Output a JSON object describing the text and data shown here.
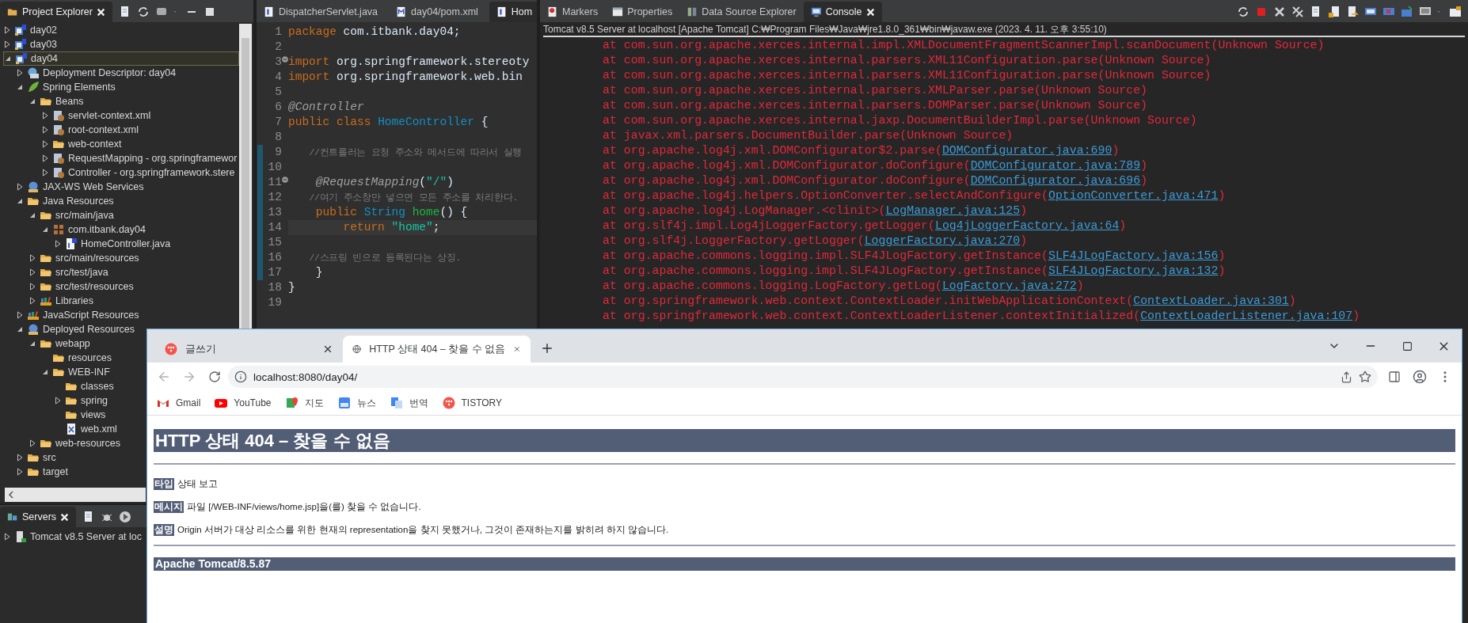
{
  "project_explorer": {
    "title": "Project Explorer",
    "tree": [
      {
        "label": "day02",
        "kind": "project",
        "expandable": true,
        "expanded": false,
        "selected": false
      },
      {
        "label": "day03",
        "kind": "project",
        "expandable": true,
        "expanded": false,
        "selected": false
      },
      {
        "label": "day04",
        "kind": "project",
        "expandable": true,
        "expanded": true,
        "selected": true,
        "children": [
          {
            "label": "Deployment Descriptor: day04",
            "kind": "descriptor",
            "expandable": true,
            "expanded": false,
            "selected": false
          },
          {
            "label": "Spring Elements",
            "kind": "spring",
            "expandable": true,
            "expanded": true,
            "selected": false,
            "children": [
              {
                "label": "Beans",
                "kind": "folder",
                "expandable": true,
                "expanded": true,
                "selected": false,
                "children": [
                  {
                    "label": "servlet-context.xml",
                    "kind": "bean-file",
                    "expandable": true,
                    "expanded": false,
                    "selected": false
                  },
                  {
                    "label": "root-context.xml",
                    "kind": "bean-file",
                    "expandable": true,
                    "expanded": false,
                    "selected": false
                  },
                  {
                    "label": "web-context",
                    "kind": "folder",
                    "expandable": true,
                    "expanded": false,
                    "selected": false
                  },
                  {
                    "label": "RequestMapping - org.springframewor",
                    "kind": "bean-file",
                    "expandable": true,
                    "expanded": false,
                    "selected": false
                  },
                  {
                    "label": "Controller - org.springframework.stere",
                    "kind": "bean-file",
                    "expandable": true,
                    "expanded": false,
                    "selected": false
                  }
                ]
              }
            ]
          },
          {
            "label": "JAX-WS Web Services",
            "kind": "services",
            "expandable": true,
            "expanded": false,
            "selected": false
          },
          {
            "label": "Java Resources",
            "kind": "folder",
            "expandable": true,
            "expanded": true,
            "selected": false,
            "children": [
              {
                "label": "src/main/java",
                "kind": "folder",
                "expandable": true,
                "expanded": true,
                "selected": false,
                "children": [
                  {
                    "label": "com.itbank.day04",
                    "kind": "package",
                    "expandable": true,
                    "expanded": true,
                    "selected": false,
                    "children": [
                      {
                        "label": "HomeController.java",
                        "kind": "java",
                        "expandable": true,
                        "expanded": false,
                        "selected": false
                      }
                    ]
                  }
                ]
              },
              {
                "label": "src/main/resources",
                "kind": "folder",
                "expandable": true,
                "expanded": false,
                "selected": false
              },
              {
                "label": "src/test/java",
                "kind": "folder",
                "expandable": true,
                "expanded": false,
                "selected": false
              },
              {
                "label": "src/test/resources",
                "kind": "folder",
                "expandable": true,
                "expanded": false,
                "selected": false
              },
              {
                "label": "Libraries",
                "kind": "library",
                "expandable": true,
                "expanded": false,
                "selected": false
              }
            ]
          },
          {
            "label": "JavaScript Resources",
            "kind": "library",
            "expandable": true,
            "expanded": false,
            "selected": false
          },
          {
            "label": "Deployed Resources",
            "kind": "services",
            "expandable": true,
            "expanded": true,
            "selected": false,
            "children": [
              {
                "label": "webapp",
                "kind": "folder",
                "expandable": true,
                "expanded": true,
                "selected": false,
                "children": [
                  {
                    "label": "resources",
                    "kind": "folder",
                    "expandable": false,
                    "selected": false
                  },
                  {
                    "label": "WEB-INF",
                    "kind": "folder",
                    "expandable": true,
                    "expanded": true,
                    "selected": false,
                    "children": [
                      {
                        "label": "classes",
                        "kind": "folder",
                        "expandable": false,
                        "selected": false
                      },
                      {
                        "label": "spring",
                        "kind": "folder",
                        "expandable": true,
                        "expanded": false,
                        "selected": false
                      },
                      {
                        "label": "views",
                        "kind": "folder",
                        "expandable": false,
                        "selected": false
                      },
                      {
                        "label": "web.xml",
                        "kind": "xml",
                        "expandable": false,
                        "selected": false
                      }
                    ]
                  }
                ]
              },
              {
                "label": "web-resources",
                "kind": "folder",
                "expandable": true,
                "expanded": false,
                "selected": false
              }
            ]
          },
          {
            "label": "src",
            "kind": "folder",
            "expandable": true,
            "expanded": false,
            "selected": false
          },
          {
            "label": "target",
            "kind": "folder",
            "expandable": true,
            "expanded": false,
            "selected": false
          }
        ]
      }
    ]
  },
  "servers": {
    "title": "Servers",
    "items": [
      {
        "label": "Tomcat v8.5 Server at loc",
        "expandable": true,
        "expanded": false,
        "selected": false
      }
    ]
  },
  "editor": {
    "tabs": [
      {
        "label": "DispatcherServlet.java",
        "kind": "java",
        "selected": false
      },
      {
        "label": "day04/pom.xml",
        "kind": "maven",
        "selected": false
      },
      {
        "label": "Hom",
        "kind": "java",
        "selected": true
      }
    ],
    "lines": [
      {
        "number": "1",
        "changed": false,
        "fold": false,
        "current": false,
        "tokens": [
          {
            "kind": "keyword",
            "t": "package"
          },
          {
            "kind": "plain",
            "t": " com.itbank.day04;"
          }
        ]
      },
      {
        "number": "2",
        "changed": false,
        "fold": false,
        "current": false
      },
      {
        "number": "3",
        "changed": false,
        "fold": true,
        "current": false,
        "tokens": [
          {
            "kind": "keyword",
            "t": "import"
          },
          {
            "kind": "plain",
            "t": " org.springframework.stereoty"
          }
        ]
      },
      {
        "number": "4",
        "changed": false,
        "fold": false,
        "current": false,
        "tokens": [
          {
            "kind": "keyword",
            "t": "import"
          },
          {
            "kind": "plain",
            "t": " org.springframework.web.bin"
          }
        ]
      },
      {
        "number": "5",
        "changed": false,
        "fold": false,
        "current": false
      },
      {
        "number": "6",
        "changed": false,
        "fold": false,
        "current": false,
        "tokens": [
          {
            "kind": "annotation",
            "t": "@Controller"
          }
        ]
      },
      {
        "number": "7",
        "changed": false,
        "fold": false,
        "current": false,
        "tokens": [
          {
            "kind": "keyword",
            "t": "public class "
          },
          {
            "kind": "type",
            "t": "HomeController"
          },
          {
            "kind": "plain",
            "t": " {"
          }
        ]
      },
      {
        "number": "8",
        "changed": false,
        "fold": false,
        "current": false
      },
      {
        "number": "9",
        "changed": true,
        "fold": false,
        "current": false,
        "tokens": [
          {
            "kind": "comment",
            "t": "    //컨트롤러는 요청 주소와 메서드에 따라서 실행"
          }
        ]
      },
      {
        "number": "10",
        "changed": true,
        "fold": false,
        "current": false
      },
      {
        "number": "11",
        "changed": true,
        "fold": true,
        "current": false,
        "tokens": [
          {
            "kind": "annotation",
            "t": "    @RequestMapping"
          },
          {
            "kind": "plain",
            "t": "("
          },
          {
            "kind": "string",
            "t": "\"/\""
          },
          {
            "kind": "plain",
            "t": ")"
          }
        ]
      },
      {
        "number": "12",
        "changed": true,
        "fold": false,
        "current": false,
        "tokens": [
          {
            "kind": "comment",
            "t": "    //여기 주소창만 넣으면 모든 주소를 처리한다."
          }
        ]
      },
      {
        "number": "13",
        "changed": true,
        "fold": false,
        "current": false,
        "tokens": [
          {
            "kind": "keyword",
            "t": "    public "
          },
          {
            "kind": "type",
            "t": "String "
          },
          {
            "kind": "method",
            "t": "home"
          },
          {
            "kind": "plain",
            "t": "() {"
          }
        ]
      },
      {
        "number": "14",
        "changed": true,
        "fold": false,
        "current": true,
        "tokens": [
          {
            "kind": "keyword",
            "t": "        return "
          },
          {
            "kind": "string",
            "t": "\"home\""
          },
          {
            "kind": "plain",
            "t": ";"
          }
        ]
      },
      {
        "number": "15",
        "changed": true,
        "fold": false,
        "current": false
      },
      {
        "number": "16",
        "changed": true,
        "fold": false,
        "current": false,
        "tokens": [
          {
            "kind": "comment",
            "t": "    //스프링 빈으로 등록된다는 상징."
          }
        ]
      },
      {
        "number": "17",
        "changed": true,
        "fold": false,
        "current": false,
        "tokens": [
          {
            "kind": "plain",
            "t": "    }"
          }
        ]
      },
      {
        "number": "18",
        "changed": false,
        "fold": false,
        "current": false,
        "tokens": [
          {
            "kind": "plain",
            "t": "}"
          }
        ]
      },
      {
        "number": "19",
        "changed": false,
        "fold": false,
        "current": false
      }
    ]
  },
  "console": {
    "tabs": [
      {
        "label": "Markers",
        "kind": "markers",
        "selected": false
      },
      {
        "label": "Properties",
        "kind": "properties",
        "selected": false
      },
      {
        "label": "Data Source Explorer",
        "kind": "datasource",
        "selected": false
      },
      {
        "label": "Console",
        "kind": "console",
        "selected": true
      }
    ],
    "header": "Tomcat v8.5 Server at localhost [Apache Tomcat] C:₩Program Files₩Java₩jre1.8.0_361₩bin₩javaw.exe (2023. 4. 11. 오후 3:55:10)",
    "lines": [
      {
        "text": "at com.sun.org.apache.xerces.internal.impl.XMLDocumentFragmentScannerImpl.scanDocument(Unknown Source)"
      },
      {
        "text": "at com.sun.org.apache.xerces.internal.parsers.XML11Configuration.parse(Unknown Source)"
      },
      {
        "text": "at com.sun.org.apache.xerces.internal.parsers.XML11Configuration.parse(Unknown Source)"
      },
      {
        "text": "at com.sun.org.apache.xerces.internal.parsers.XMLParser.parse(Unknown Source)"
      },
      {
        "text": "at com.sun.org.apache.xerces.internal.parsers.DOMParser.parse(Unknown Source)"
      },
      {
        "text": "at com.sun.org.apache.xerces.internal.jaxp.DocumentBuilderImpl.parse(Unknown Source)"
      },
      {
        "text": "at javax.xml.parsers.DocumentBuilder.parse(Unknown Source)"
      },
      {
        "text": "at org.apache.log4j.xml.DOMConfigurator$2.parse(",
        "link": "DOMConfigurator.java:690",
        "tail": ")"
      },
      {
        "text": "at org.apache.log4j.xml.DOMConfigurator.doConfigure(",
        "link": "DOMConfigurator.java:789",
        "tail": ")"
      },
      {
        "text": "at org.apache.log4j.xml.DOMConfigurator.doConfigure(",
        "link": "DOMConfigurator.java:696",
        "tail": ")"
      },
      {
        "text": "at org.apache.log4j.helpers.OptionConverter.selectAndConfigure(",
        "link": "OptionConverter.java:471",
        "tail": ")"
      },
      {
        "text": "at org.apache.log4j.LogManager.<clinit>(",
        "link": "LogManager.java:125",
        "tail": ")"
      },
      {
        "text": "at org.slf4j.impl.Log4jLoggerFactory.getLogger(",
        "link": "Log4jLoggerFactory.java:64",
        "tail": ")"
      },
      {
        "text": "at org.slf4j.LoggerFactory.getLogger(",
        "link": "LoggerFactory.java:270",
        "tail": ")"
      },
      {
        "text": "at org.apache.commons.logging.impl.SLF4JLogFactory.getInstance(",
        "link": "SLF4JLogFactory.java:156",
        "tail": ")"
      },
      {
        "text": "at org.apache.commons.logging.impl.SLF4JLogFactory.getInstance(",
        "link": "SLF4JLogFactory.java:132",
        "tail": ")"
      },
      {
        "text": "at org.apache.commons.logging.LogFactory.getLog(",
        "link": "LogFactory.java:272",
        "tail": ")"
      },
      {
        "text": "at org.springframework.web.context.ContextLoader.initWebApplicationContext(",
        "link": "ContextLoader.java:301",
        "tail": ")"
      },
      {
        "text": "at org.springframework.web.context.ContextLoaderListener.contextInitialized(",
        "link": "ContextLoaderListener.java:107",
        "tail": ")"
      }
    ]
  },
  "browser": {
    "tabs": [
      {
        "title": "글쓰기",
        "kind": "tistory",
        "selected": false
      },
      {
        "title": "HTTP 상태 404 – 찾을 수 없음",
        "kind": "globe",
        "selected": true
      }
    ],
    "address": "localhost:8080/day04/",
    "bookmarks": [
      {
        "label": "Gmail",
        "kind": "gmail"
      },
      {
        "label": "YouTube",
        "kind": "youtube"
      },
      {
        "label": "지도",
        "kind": "maps"
      },
      {
        "label": "뉴스",
        "kind": "news"
      },
      {
        "label": "번역",
        "kind": "translate"
      },
      {
        "label": "TISTORY",
        "kind": "tistory"
      }
    ],
    "page": {
      "heading": "HTTP 상태 404 – 찾을 수 없음",
      "fields": [
        {
          "label": "타입",
          "value": "상태 보고"
        },
        {
          "label": "메시지",
          "value": "파일 [/WEB-INF/views/home.jsp]을(를) 찾을 수 없습니다."
        },
        {
          "label": "설명",
          "value": "Origin 서버가 대상 리소스를 위한 현재의 representation을 찾지 못했거나, 그것이 존재하는지를 밝히려 하지 않습니다."
        }
      ],
      "footer": "Apache Tomcat/8.5.87"
    }
  }
}
